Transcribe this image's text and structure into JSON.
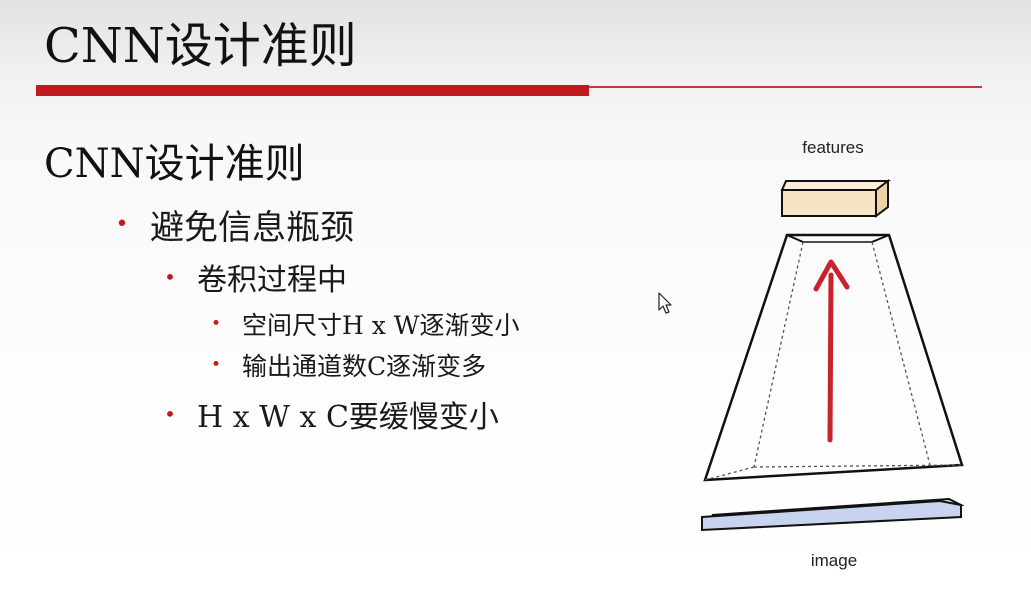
{
  "slide": {
    "title": "CNN设计准则",
    "heading": "CNN设计准则"
  },
  "bullets": {
    "avoid_bottleneck": "避免信息瓶颈",
    "conv_process": "卷积过程中",
    "spatial_size": "空间尺寸H x W逐渐变小",
    "channels": "输出通道数C逐渐变多",
    "hwc": "H x W x C要缓慢变小"
  },
  "diagram": {
    "top_label": "features",
    "bottom_label": "image"
  },
  "colors": {
    "accent_red": "#c0191f",
    "bullet_red": "#c4161c",
    "features_fill": "#f6e4c2",
    "image_fill": "#c8d4ef",
    "arrow_red": "#c8232b"
  },
  "icons": {
    "cursor": "mouse-pointer-icon"
  }
}
